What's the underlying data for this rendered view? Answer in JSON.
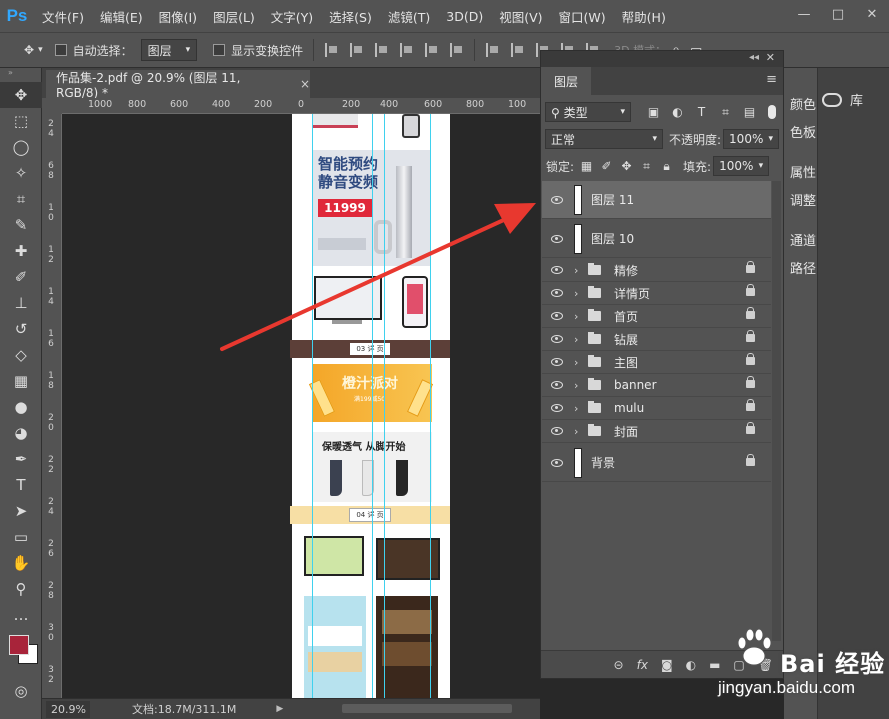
{
  "app": {
    "logo": "Ps"
  },
  "menu": [
    "文件(F)",
    "编辑(E)",
    "图像(I)",
    "图层(L)",
    "文字(Y)",
    "选择(S)",
    "滤镜(T)",
    "3D(D)",
    "视图(V)",
    "窗口(W)",
    "帮助(H)"
  ],
  "window_controls": {
    "minimize": "—",
    "maximize": "□",
    "close": "✕"
  },
  "options": {
    "auto_select_label": "自动选择：",
    "auto_select_value": "图层",
    "show_transform_label": "显示变换控件",
    "mode_3d_label": "3D 模式："
  },
  "document": {
    "tab_title": "作品集-2.pdf @ 20.9% (图层 11, RGB/8) *",
    "close": "×"
  },
  "ruler_h": [
    "1000",
    "800",
    "600",
    "400",
    "200",
    "0",
    "200",
    "400",
    "600",
    "800",
    "100"
  ],
  "ruler_v": [
    "2",
    "4",
    "6",
    "8",
    "1",
    "0",
    "1",
    "2",
    "1",
    "4",
    "1",
    "6",
    "1",
    "8",
    "2",
    "0",
    "2",
    "2",
    "2",
    "4",
    "2",
    "6",
    "2",
    "8",
    "3",
    "0",
    "3",
    "2"
  ],
  "canvas_content": {
    "promo1_title1": "智能预约",
    "promo1_title2": "静音变频",
    "promo1_price": "11999",
    "section3_label": "03 详 页",
    "promo2_title": "橙汁派对",
    "promo2_sub": "满199减50",
    "promo3_title": "保暖透气 从脚开始",
    "section4_label": "04 详 页"
  },
  "status": {
    "zoom": "20.9%",
    "doc_info": "文档:18.7M/311.1M",
    "arrow": "▶"
  },
  "layers_panel": {
    "tab_label": "图层",
    "filter_label": "类型",
    "blend_mode": "正常",
    "opacity_label": "不透明度:",
    "opacity_value": "100%",
    "lock_label": "锁定:",
    "fill_label": "填充:",
    "fill_value": "100%",
    "layers": [
      {
        "name": "图层 11",
        "kind": "pixel",
        "selected": true,
        "locked": false
      },
      {
        "name": "图层 10",
        "kind": "pixel",
        "selected": false,
        "locked": false
      },
      {
        "name": "精修",
        "kind": "group",
        "selected": false,
        "locked": true
      },
      {
        "name": "详情页",
        "kind": "group",
        "selected": false,
        "locked": true
      },
      {
        "name": "首页",
        "kind": "group",
        "selected": false,
        "locked": true
      },
      {
        "name": "钻展",
        "kind": "group",
        "selected": false,
        "locked": true
      },
      {
        "name": "主图",
        "kind": "group",
        "selected": false,
        "locked": true
      },
      {
        "name": "banner",
        "kind": "group",
        "selected": false,
        "locked": true
      },
      {
        "name": "mulu",
        "kind": "group",
        "selected": false,
        "locked": true
      },
      {
        "name": "封面",
        "kind": "group",
        "selected": false,
        "locked": true
      },
      {
        "name": "背景",
        "kind": "background",
        "selected": false,
        "locked": true
      }
    ],
    "bottom_icons": [
      "link-icon",
      "fx-icon",
      "mask-icon",
      "adjustment-icon",
      "group-icon",
      "new-layer-icon",
      "delete-icon"
    ]
  },
  "right_panels": {
    "items": [
      "颜色",
      "色板",
      "属性",
      "调整",
      "通道",
      "路径"
    ],
    "library": "库"
  },
  "watermark": {
    "brand": "Bai 经验",
    "url": "jingyan.baidu.com"
  },
  "colors": {
    "ui_dark": "#535353",
    "canvas_bg": "#282828",
    "guide": "#3fd1ee",
    "arrow": "#e8382f",
    "foreground_swatch": "#a8243a",
    "background_swatch": "#ffffff",
    "ps_blue": "#31a8ff"
  }
}
